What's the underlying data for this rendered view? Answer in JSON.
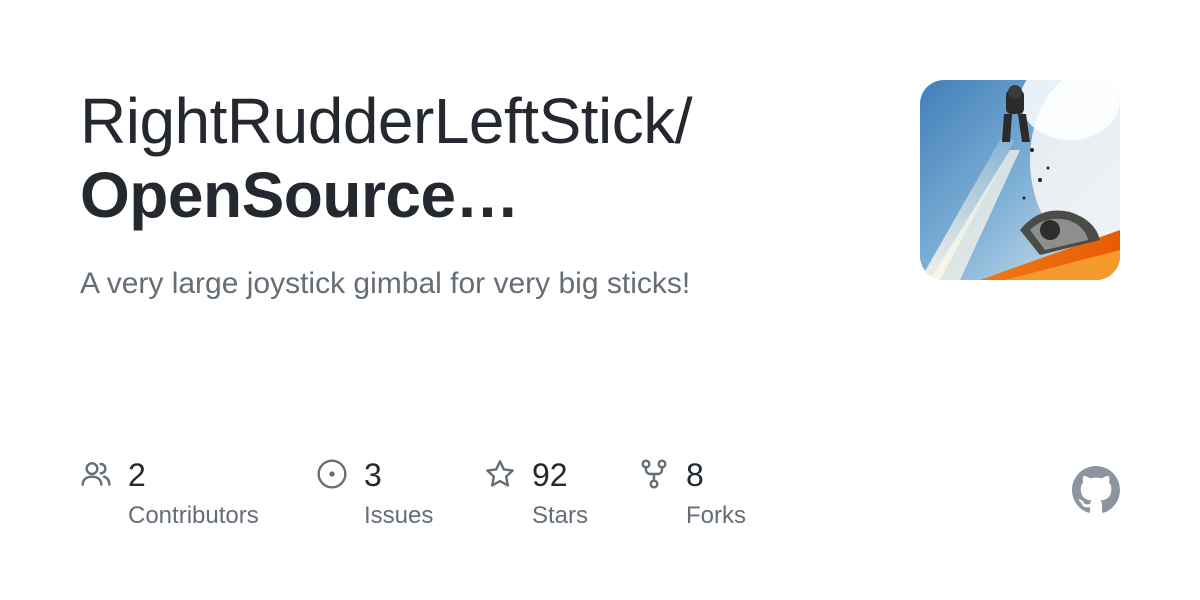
{
  "repo": {
    "owner": "RightRudderLeftStick/",
    "name": "OpenSource-...",
    "description": "A very large joystick gimbal for very big sticks!"
  },
  "stats": {
    "contributors": {
      "value": "2",
      "label": "Contributors",
      "icon": "people-icon"
    },
    "issues": {
      "value": "3",
      "label": "Issues",
      "icon": "issue-opened-icon"
    },
    "stars": {
      "value": "92",
      "label": "Stars",
      "icon": "star-icon"
    },
    "forks": {
      "value": "8",
      "label": "Forks",
      "icon": "repo-forked-icon"
    }
  },
  "colors": {
    "title": "#24292f",
    "muted": "#656d76",
    "github_mark": "#8c959f"
  },
  "avatar": {
    "icon": "repository-owner-avatar"
  },
  "brand": {
    "icon": "github-mark-icon"
  }
}
